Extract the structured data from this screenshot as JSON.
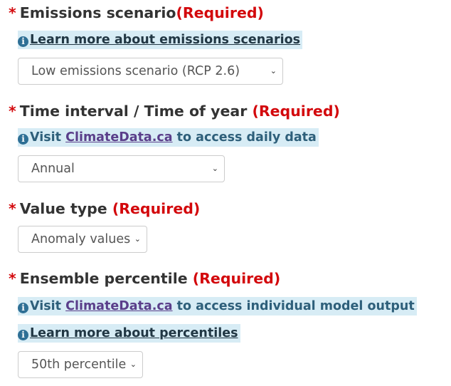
{
  "emissions": {
    "label": "Emissions scenario",
    "required": "(Required)",
    "info_link": "Learn more about emissions scenarios",
    "selected": "Low emissions scenario (RCP 2.6)"
  },
  "time_interval": {
    "label": "Time interval / Time of year",
    "required": "(Required)",
    "info_prefix": "Visit ",
    "info_link": "ClimateData.ca",
    "info_suffix": " to access daily data",
    "selected": "Annual"
  },
  "value_type": {
    "label": "Value type",
    "required": "(Required)",
    "selected": "Anomaly values"
  },
  "ensemble": {
    "label": "Ensemble percentile",
    "required": "(Required)",
    "info_prefix": "Visit ",
    "info_link": "ClimateData.ca",
    "info_suffix": " to access individual model output",
    "info2_link": "Learn more about percentiles",
    "selected": "50th percentile"
  },
  "icons": {
    "required_marker": "*",
    "info": "i",
    "chevron": "⌄"
  },
  "colors": {
    "required": "#d3080c",
    "info_bg": "#d7ecf5",
    "info_text": "#2e5f7a",
    "link_visited": "#5a3e8a"
  }
}
